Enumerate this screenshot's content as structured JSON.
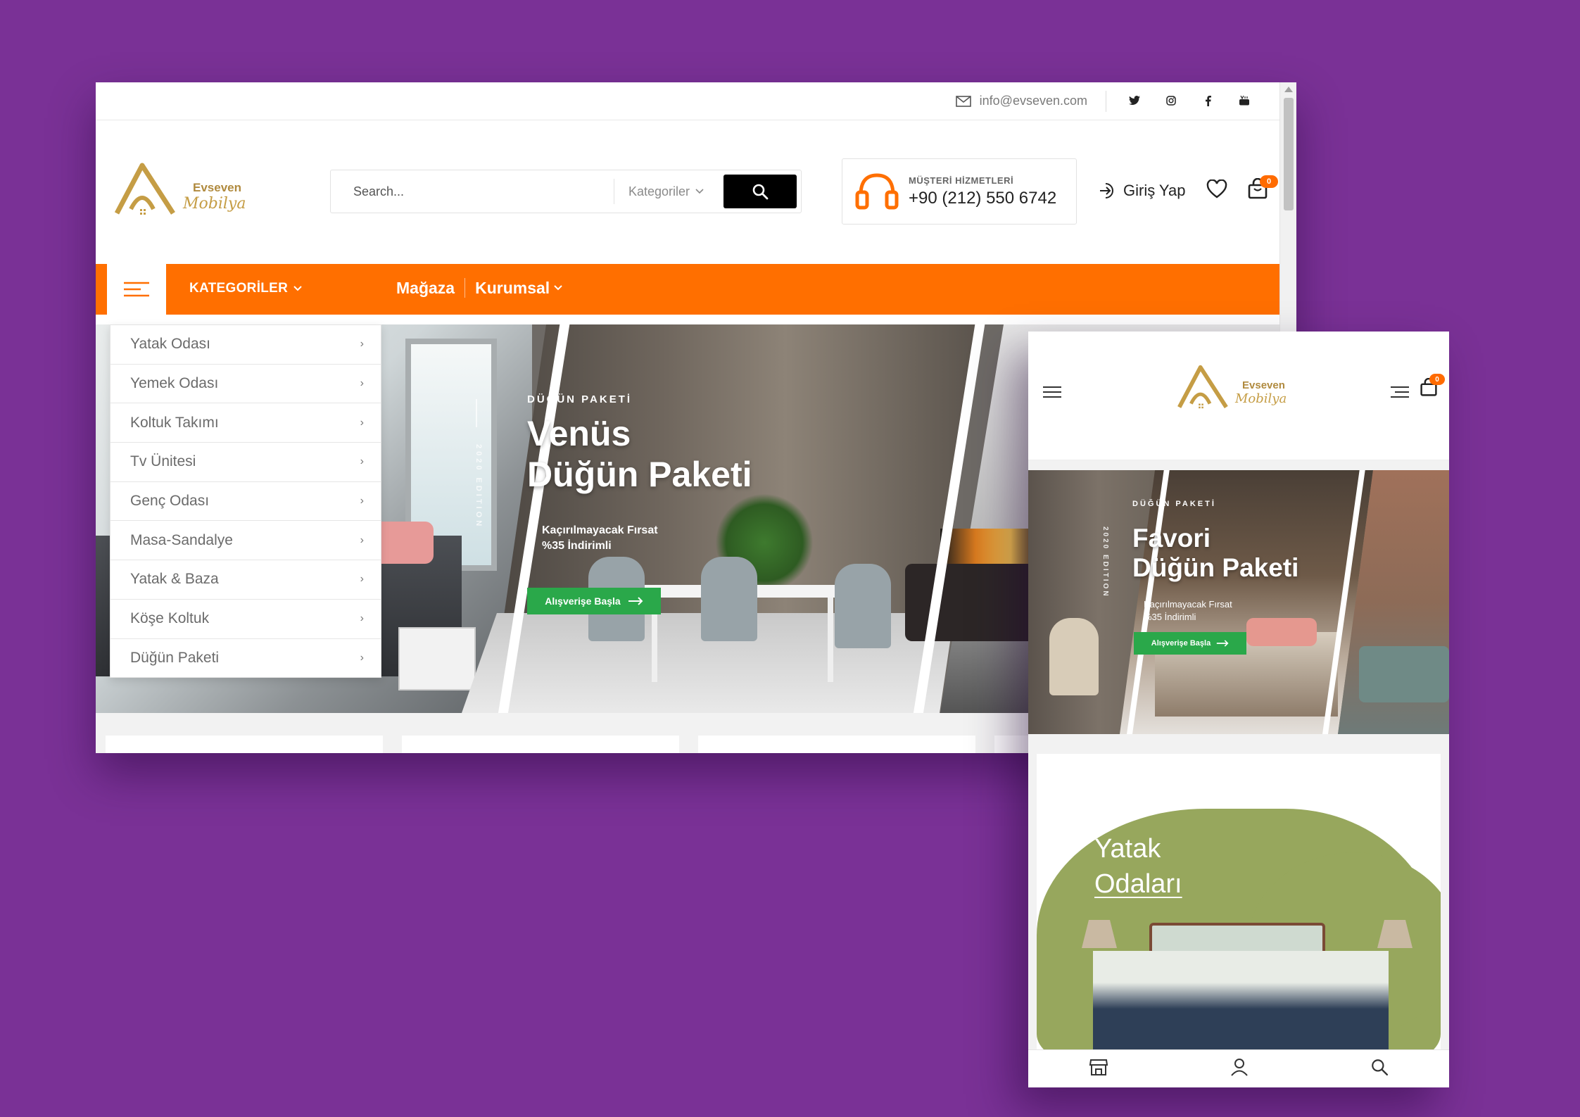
{
  "desktop": {
    "topbar": {
      "email": "info@evseven.com",
      "social": [
        "twitter-icon",
        "instagram-icon",
        "facebook-icon",
        "youtube-icon"
      ]
    },
    "logo": {
      "line1": "Evseven",
      "line2": "Mobilya"
    },
    "search": {
      "placeholder": "Search...",
      "category_label": "Kategoriler"
    },
    "support": {
      "label": "MÜŞTERİ HİZMETLERİ",
      "phone": "+90 (212) 550 6742"
    },
    "account": {
      "login_label": "Giriş Yap",
      "cart_count": "0"
    },
    "nav": {
      "categories_label": "KATEGORİLER",
      "links": [
        "Mağaza",
        "Kurumsal"
      ]
    },
    "category_menu": [
      "Yatak Odası",
      "Yemek Odası",
      "Koltuk Takımı",
      "Tv Ünitesi",
      "Genç Odası",
      "Masa-Sandalye",
      "Yatak & Baza",
      "Köşe Koltuk",
      "Düğün Paketi"
    ],
    "hero": {
      "kicker": "DÜĞÜN PAKETİ",
      "title_line1": "Venüs",
      "title_line2": "Düğün Paketi",
      "sub_line1": "Kaçırılmayacak Fırsat",
      "sub_line2": "%35 İndirimli",
      "cta": "Alışverişe Başla",
      "edition": "2020 EDITION"
    }
  },
  "mobile": {
    "logo": {
      "line1": "Evseven",
      "line2": "Mobilya"
    },
    "cart_count": "0",
    "hero": {
      "kicker": "DÜĞÜN PAKETİ",
      "title_line1": "Favori",
      "title_line2": "Düğün Paketi",
      "sub_line1": "Kaçırılmayacak Fırsat",
      "sub_line2": "%35 İndirimli",
      "cta": "Alışverişe Başla",
      "edition": "2020 EDITION"
    },
    "promo": {
      "line1": "Yatak",
      "line2": "Odaları"
    },
    "tabbar": [
      "store-icon",
      "user-icon",
      "search-icon"
    ]
  },
  "colors": {
    "background": "#7a3196",
    "accent": "#ff6f00",
    "cta": "#2aa84a",
    "logo": "#b08a3e",
    "promo_green": "#97a75d"
  }
}
